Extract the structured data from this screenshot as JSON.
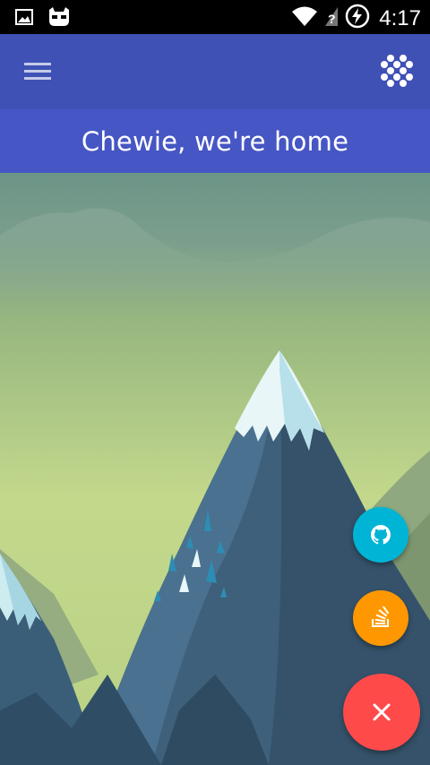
{
  "status_bar": {
    "time": "4:17",
    "icons": [
      "image-icon",
      "cyanogen-icon",
      "wifi-icon",
      "no-signal-icon",
      "battery-charging-icon"
    ]
  },
  "toolbar": {
    "menu_icon": "hamburger-menu-icon",
    "action_icon": "dots-grid-icon",
    "color": "#3f51b5"
  },
  "header": {
    "title": "Chewie, we're home"
  },
  "fab_menu": {
    "items": [
      {
        "icon": "github-icon",
        "color": "#00b4d6"
      },
      {
        "icon": "stackoverflow-icon",
        "color": "#ff9800"
      }
    ],
    "main": {
      "icon": "close-icon",
      "color": "#ff4a4a"
    }
  }
}
